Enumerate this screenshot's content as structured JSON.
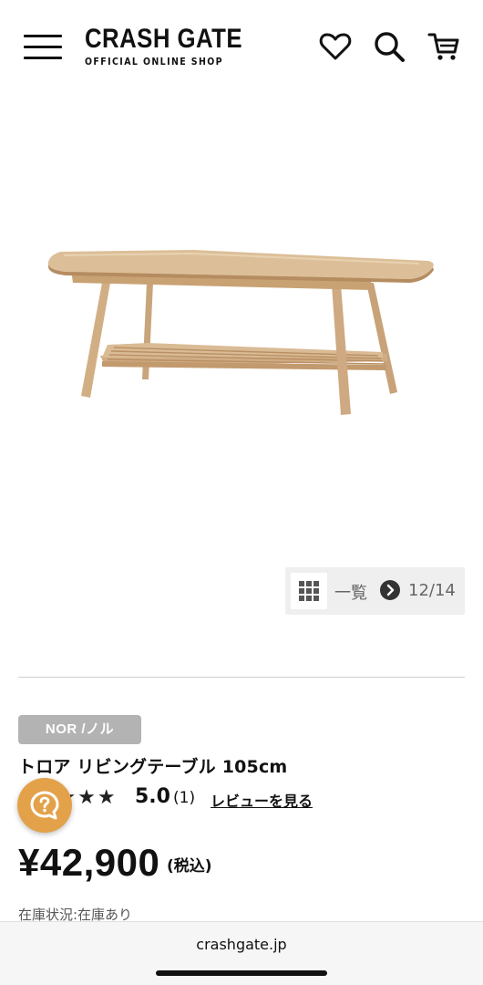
{
  "header": {
    "logo_main": "CRASH GATE",
    "logo_sub": "OFFICIAL ONLINE SHOP",
    "icons": [
      "menu-icon",
      "heart-icon",
      "search-icon",
      "cart-icon"
    ]
  },
  "gallery": {
    "list_label": "一覧",
    "page_count": "12/14"
  },
  "product": {
    "brand_tag": "NOR /ノル",
    "title": "トロア リビングテーブル 105cm",
    "stars": "★★★★★",
    "rating_score": "5.0",
    "rating_count": "(1)",
    "review_link": "レビューを見る",
    "price": "¥42,900",
    "tax_label": "(税込)",
    "stock": "在庫状況:在庫あり"
  },
  "browser": {
    "url": "crashgate.jp"
  },
  "colors": {
    "chat_button": "#e3a24a",
    "brand_tag": "#b3b3b3",
    "wood": "#d8b890"
  }
}
